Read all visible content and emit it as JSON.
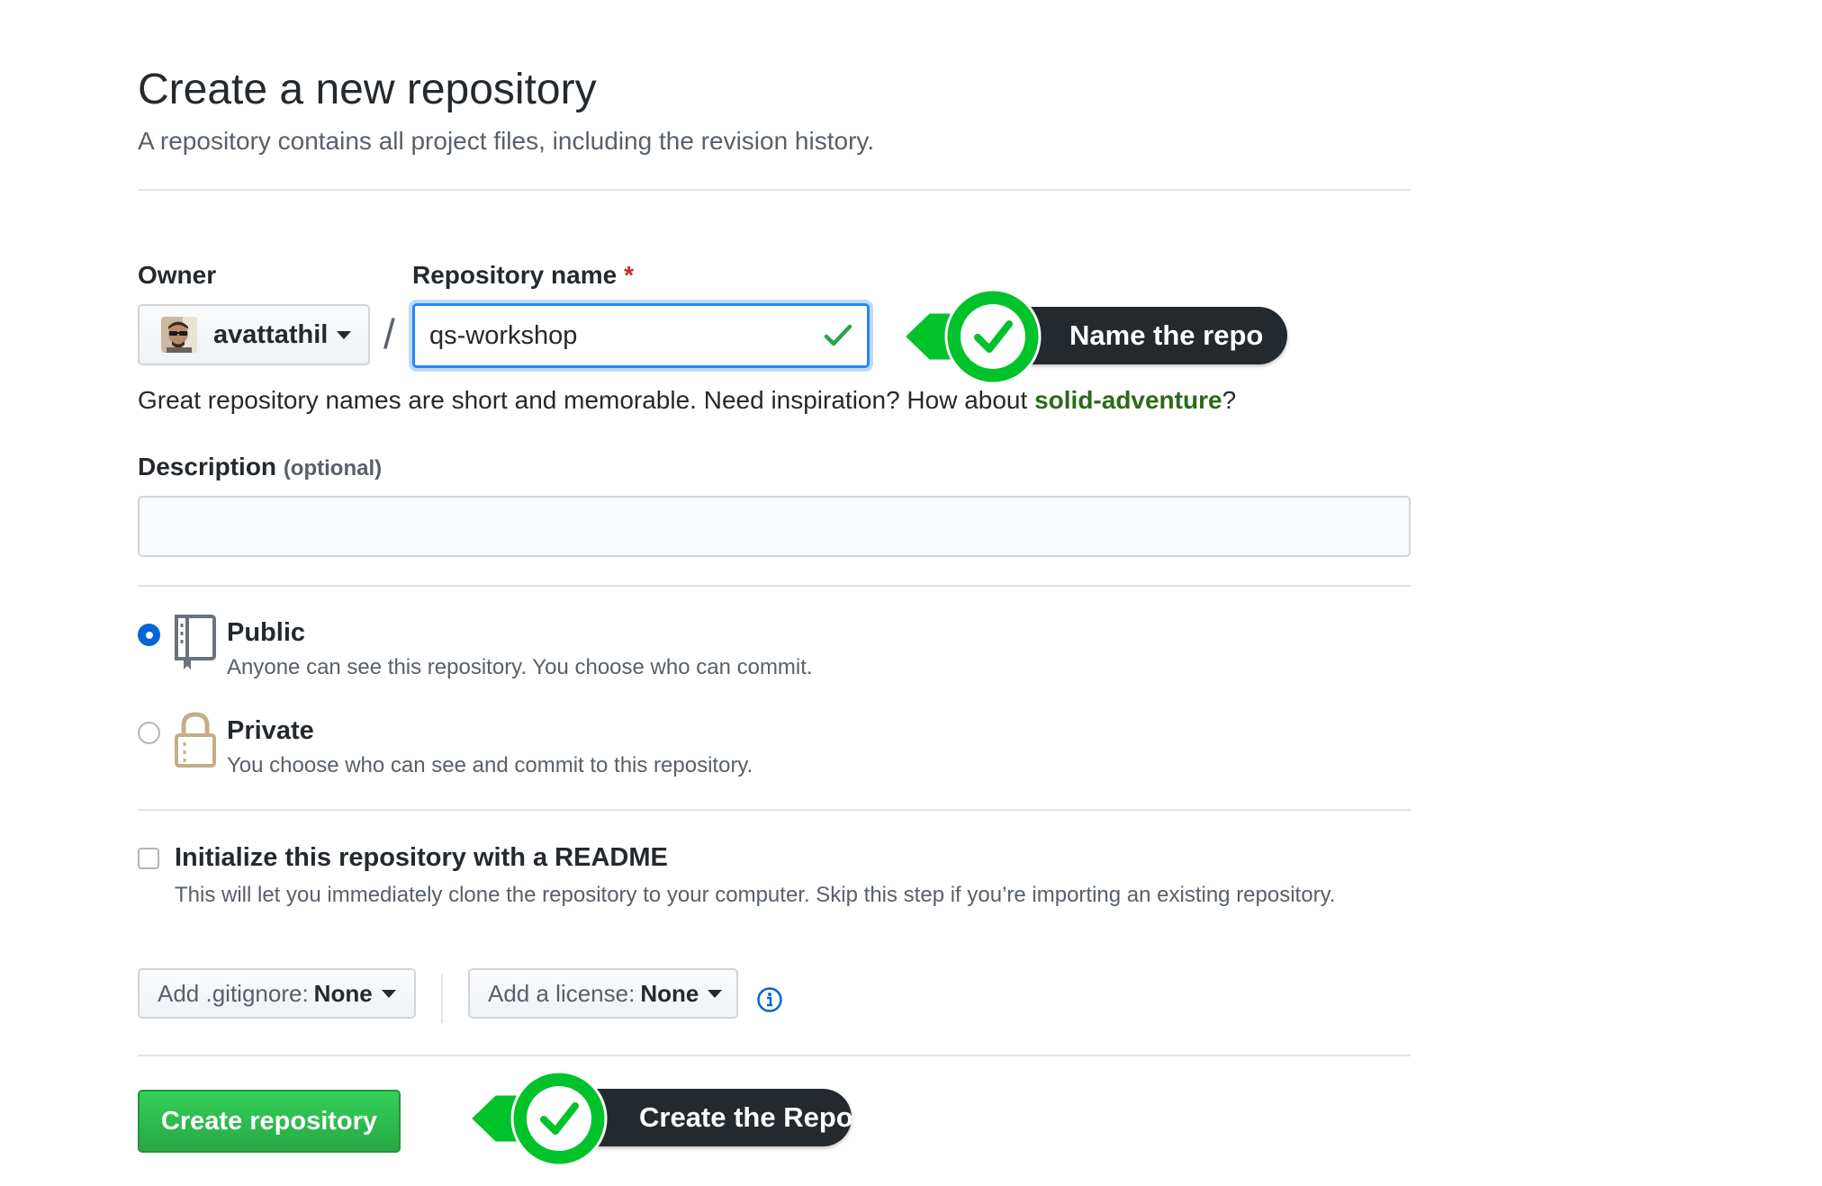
{
  "header": {
    "title": "Create a new repository",
    "subtitle": "A repository contains all project files, including the revision history."
  },
  "owner": {
    "label": "Owner",
    "value": "avattathil"
  },
  "repo_name": {
    "label": "Repository name",
    "required_mark": "*",
    "value": "qs-workshop",
    "separator": "/"
  },
  "hint": {
    "text": "Great repository names are short and memorable. Need inspiration? How about ",
    "suggestion": "solid-adventure",
    "suffix": "?"
  },
  "description": {
    "label": "Description",
    "optional": "(optional)",
    "value": ""
  },
  "visibility": {
    "public": {
      "title": "Public",
      "desc": "Anyone can see this repository. You choose who can commit.",
      "selected": true
    },
    "private": {
      "title": "Private",
      "desc": "You choose who can see and commit to this repository.",
      "selected": false
    }
  },
  "readme": {
    "title": "Initialize this repository with a README",
    "desc": "This will let you immediately clone the repository to your computer. Skip this step if you’re importing an existing repository.",
    "checked": false
  },
  "gitignore": {
    "label": "Add .gitignore:",
    "value": "None"
  },
  "license": {
    "label": "Add a license:",
    "value": "None"
  },
  "submit": {
    "label": "Create repository"
  },
  "callouts": {
    "name": "Name the repo",
    "create": "Create the Repo"
  },
  "colors": {
    "accent_blue": "#0366d6",
    "success_green": "#28a745",
    "callout_green": "#00c22a",
    "callout_dark": "#24292e"
  },
  "icons": [
    "check-icon",
    "caret-down-icon",
    "repo-book-icon",
    "lock-icon",
    "info-icon",
    "checkmark-badge-icon"
  ]
}
